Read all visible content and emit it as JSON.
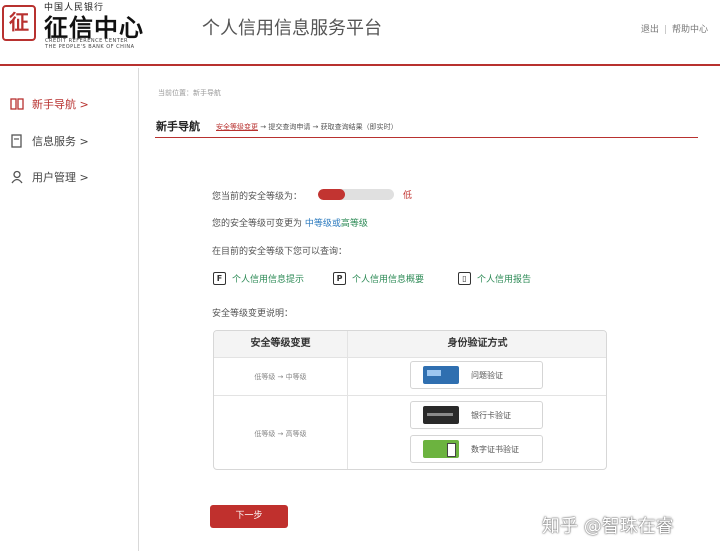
{
  "header": {
    "logo_seal": "征",
    "logo_top": "中国人民银行",
    "logo_main": "征信中心",
    "logo_en_line1": "CREDIT REFERENCE CENTER",
    "logo_en_line2": "THE PEOPLE'S BANK OF CHINA",
    "title": "个人信用信息服务平台",
    "links": [
      "退出",
      "帮助中心"
    ],
    "accent_color": "#b8312f"
  },
  "sidebar": {
    "items": [
      {
        "label": "新手导航 >",
        "icon": "book-icon",
        "active": true
      },
      {
        "label": "信息服务 >",
        "icon": "document-icon",
        "active": false
      },
      {
        "label": "用户管理 >",
        "icon": "user-icon",
        "active": false
      }
    ]
  },
  "main": {
    "breadcrumb": "当前位置：新手导航",
    "nav_title": "新手导航",
    "steps_current": "安全等级变更",
    "steps_rest": " → 提交查询申请 → 获取查询结果（即实时）",
    "security_prefix": "您当前的安全等级为：",
    "security_level_text": "低",
    "security_level_fraction": 0.35,
    "change_prefix": "您的安全等级可变更为",
    "change_mid": "中等级",
    "change_or": "或",
    "change_high": "高等级",
    "query_intro": "在目前的安全等级下您可以查询：",
    "services": [
      {
        "label": "个人信用信息提示",
        "icon": "doc-f-icon"
      },
      {
        "label": "个人信用信息概要",
        "icon": "doc-p-icon"
      },
      {
        "label": "个人信用报告",
        "icon": "book-report-icon"
      }
    ],
    "explain_title": "安全等级变更说明：",
    "table": {
      "col1": "安全等级变更",
      "col2": "身份验证方式",
      "rows": [
        {
          "change": "低等级 → 中等级",
          "methods": [
            {
              "label": "问题验证",
              "icon": "question-card-icon"
            }
          ]
        },
        {
          "change": "低等级 → 高等级",
          "methods": [
            {
              "label": "银行卡验证",
              "icon": "bank-card-icon"
            },
            {
              "label": "数字证书验证",
              "icon": "cert-usb-icon"
            }
          ]
        }
      ]
    },
    "next_button": "下一步"
  },
  "watermark": "知乎 @智珠在睿"
}
